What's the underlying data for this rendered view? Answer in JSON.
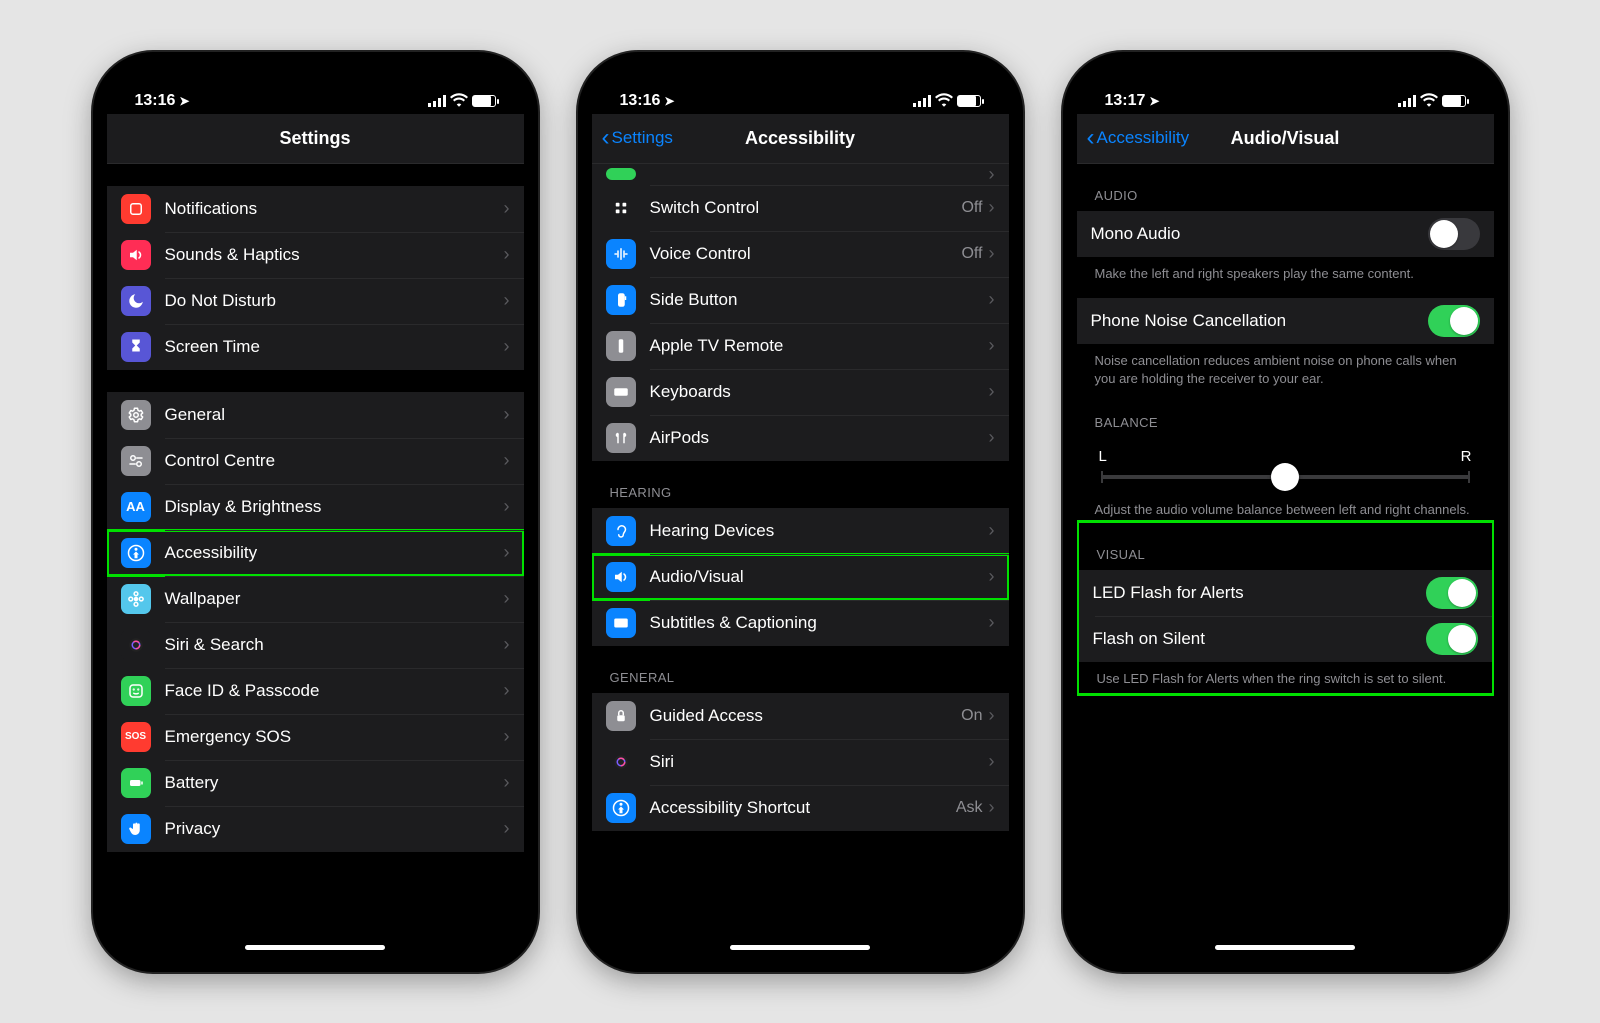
{
  "screens": [
    {
      "time": "13:16",
      "nav": {
        "title": "Settings",
        "back": null
      },
      "groups": [
        {
          "header": null,
          "rows": [
            {
              "id": "notifications",
              "label": "Notifications",
              "iconBg": "#ff3b30",
              "iconName": "notifications-icon",
              "glyph": "square"
            },
            {
              "id": "sounds",
              "label": "Sounds & Haptics",
              "iconBg": "#ff2d55",
              "iconName": "sounds-icon",
              "glyph": "speaker"
            },
            {
              "id": "dnd",
              "label": "Do Not Disturb",
              "iconBg": "#5856d6",
              "iconName": "moon-icon",
              "glyph": "moon"
            },
            {
              "id": "screentime",
              "label": "Screen Time",
              "iconBg": "#5856d6",
              "iconName": "hourglass-icon",
              "glyph": "hourglass"
            }
          ]
        },
        {
          "header": null,
          "rows": [
            {
              "id": "general",
              "label": "General",
              "iconBg": "#8e8e93",
              "iconName": "gear-icon",
              "glyph": "gear"
            },
            {
              "id": "controlcentre",
              "label": "Control Centre",
              "iconBg": "#8e8e93",
              "iconName": "switches-icon",
              "glyph": "switches"
            },
            {
              "id": "display",
              "label": "Display & Brightness",
              "iconBg": "#0a84ff",
              "iconName": "text-size-icon",
              "glyph": "AA"
            },
            {
              "id": "accessibility",
              "label": "Accessibility",
              "iconBg": "#0a84ff",
              "iconName": "accessibility-icon",
              "glyph": "person",
              "highlight": true
            },
            {
              "id": "wallpaper",
              "label": "Wallpaper",
              "iconBg": "#54c7ec",
              "iconName": "wallpaper-icon",
              "glyph": "flower"
            },
            {
              "id": "siri",
              "label": "Siri & Search",
              "iconBg": "#1c1c1e",
              "iconName": "siri-icon",
              "glyph": "siri"
            },
            {
              "id": "faceid",
              "label": "Face ID & Passcode",
              "iconBg": "#30d158",
              "iconName": "faceid-icon",
              "glyph": "face"
            },
            {
              "id": "sos",
              "label": "Emergency SOS",
              "iconBg": "#ff3b30",
              "iconName": "sos-icon",
              "glyph": "SOS"
            },
            {
              "id": "battery",
              "label": "Battery",
              "iconBg": "#30d158",
              "iconName": "battery-icon",
              "glyph": "battery"
            },
            {
              "id": "privacy",
              "label": "Privacy",
              "iconBg": "#0a84ff",
              "iconName": "privacy-icon",
              "glyph": "hand"
            }
          ]
        }
      ]
    },
    {
      "time": "13:16",
      "nav": {
        "title": "Accessibility",
        "back": "Settings"
      },
      "groups": [
        {
          "header": null,
          "rows": [
            {
              "id": "switchcontrol",
              "label": "Switch Control",
              "detail": "Off",
              "iconBg": "#1c1c1e",
              "iconName": "grid-icon",
              "glyph": "grid",
              "partialTop": true
            },
            {
              "id": "voicecontrol",
              "label": "Voice Control",
              "detail": "Off",
              "iconBg": "#0a84ff",
              "iconName": "voice-icon",
              "glyph": "voice"
            },
            {
              "id": "sidebutton",
              "label": "Side Button",
              "iconBg": "#0a84ff",
              "iconName": "side-button-icon",
              "glyph": "side"
            },
            {
              "id": "appletv",
              "label": "Apple TV Remote",
              "iconBg": "#8e8e93",
              "iconName": "remote-icon",
              "glyph": "remote"
            },
            {
              "id": "keyboards",
              "label": "Keyboards",
              "iconBg": "#8e8e93",
              "iconName": "keyboard-icon",
              "glyph": "keyboard"
            },
            {
              "id": "airpods",
              "label": "AirPods",
              "iconBg": "#8e8e93",
              "iconName": "airpods-icon",
              "glyph": "airpods"
            }
          ]
        },
        {
          "header": "Hearing",
          "rows": [
            {
              "id": "hearingdevices",
              "label": "Hearing Devices",
              "iconBg": "#0a84ff",
              "iconName": "ear-icon",
              "glyph": "ear"
            },
            {
              "id": "audiovisual",
              "label": "Audio/Visual",
              "iconBg": "#0a84ff",
              "iconName": "audio-visual-icon",
              "glyph": "speaker",
              "highlight": true
            },
            {
              "id": "subtitles",
              "label": "Subtitles & Captioning",
              "iconBg": "#0a84ff",
              "iconName": "subtitles-icon",
              "glyph": "cc"
            }
          ]
        },
        {
          "header": "General",
          "rows": [
            {
              "id": "guidedaccess",
              "label": "Guided Access",
              "detail": "On",
              "iconBg": "#8e8e93",
              "iconName": "lock-icon",
              "glyph": "lock"
            },
            {
              "id": "siri2",
              "label": "Siri",
              "iconBg": "#1c1c1e",
              "iconName": "siri-icon",
              "glyph": "siri"
            },
            {
              "id": "shortcut",
              "label": "Accessibility Shortcut",
              "detail": "Ask",
              "iconBg": "#0a84ff",
              "iconName": "accessibility-icon",
              "glyph": "person"
            }
          ]
        }
      ]
    },
    {
      "time": "13:17",
      "nav": {
        "title": "Audio/Visual",
        "back": "Accessibility"
      },
      "sections": [
        {
          "header": "Audio",
          "items": [
            {
              "type": "toggle",
              "id": "mono",
              "label": "Mono Audio",
              "on": false
            }
          ],
          "footer": "Make the left and right speakers play the same content."
        },
        {
          "header": null,
          "items": [
            {
              "type": "toggle",
              "id": "noise",
              "label": "Phone Noise Cancellation",
              "on": true
            }
          ],
          "footer": "Noise cancellation reduces ambient noise on phone calls when you are holding the receiver to your ear."
        },
        {
          "header": "Balance",
          "items": [
            {
              "type": "slider",
              "id": "balance",
              "left": "L",
              "right": "R",
              "value": 0.5
            }
          ],
          "footer": "Adjust the audio volume balance between left and right channels."
        },
        {
          "header": "Visual",
          "highlight": true,
          "items": [
            {
              "type": "toggle",
              "id": "ledflash",
              "label": "LED Flash for Alerts",
              "on": true
            },
            {
              "type": "toggle",
              "id": "flashsilent",
              "label": "Flash on Silent",
              "on": true
            }
          ],
          "footer": "Use LED Flash for Alerts when the ring switch is set to silent."
        }
      ]
    }
  ]
}
